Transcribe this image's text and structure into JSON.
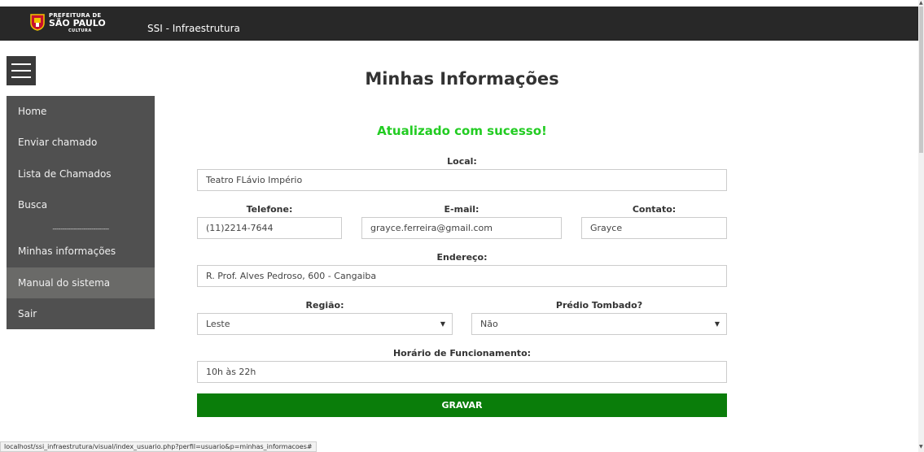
{
  "header": {
    "logo": {
      "line1": "PREFEITURA DE",
      "line2": "SÃO PAULO",
      "line3": "CULTURA"
    },
    "title": "SSI - Infraestrutura"
  },
  "sidebar": {
    "items": [
      {
        "label": "Home"
      },
      {
        "label": "Enviar chamado"
      },
      {
        "label": "Lista de Chamados"
      },
      {
        "label": "Busca"
      },
      {
        "label": "Minhas informações"
      },
      {
        "label": "Manual do sistema"
      },
      {
        "label": "Sair"
      }
    ],
    "separator": "-----------------------------"
  },
  "main": {
    "title": "Minhas Informações",
    "success_message": "Atualizado com sucesso!",
    "form": {
      "local": {
        "label": "Local:",
        "value": "Teatro FLávio Império"
      },
      "telefone": {
        "label": "Telefone:",
        "value": "(11)2214-7644"
      },
      "email": {
        "label": "E-mail:",
        "value": "grayce.ferreira@gmail.com"
      },
      "contato": {
        "label": "Contato:",
        "value": "Grayce"
      },
      "endereco": {
        "label": "Endereço:",
        "value": "R. Prof. Alves Pedroso, 600 - Cangaiba"
      },
      "regiao": {
        "label": "Região:",
        "value": "Leste"
      },
      "predio_tombado": {
        "label": "Prédio Tombado?",
        "value": "Não"
      },
      "horario": {
        "label": "Horário de Funcionamento:",
        "value": "10h às 22h"
      },
      "submit_label": "GRAVAR"
    }
  },
  "status_url": "localhost/ssi_infraestrutura/visual/index_usuario.php?perfil=usuario&p=minhas_informacoes#",
  "colors": {
    "topbar": "#282828",
    "sidebar": "#505050",
    "sidebar_active": "#6a6a68",
    "success": "#22cc22",
    "button": "#0a7d0a"
  },
  "icons": [
    "menu-icon",
    "chevron-down-icon",
    "city-crest-icon"
  ]
}
